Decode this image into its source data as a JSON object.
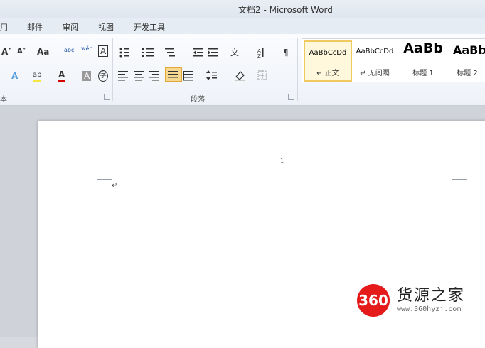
{
  "window": {
    "title": "文档2 - Microsoft Word"
  },
  "tabs": [
    "用",
    "邮件",
    "审阅",
    "视图",
    "开发工具"
  ],
  "ribbon": {
    "font_buttons": [
      "A˄",
      "A˅",
      "Aa",
      "abc",
      "wén",
      "A",
      "A",
      "ab",
      "A",
      "A",
      "字"
    ],
    "paragraph_group_label": "段落",
    "font_group_label": "本",
    "styles": [
      {
        "sample": "AaBbCcDd",
        "name": "↵ 正文"
      },
      {
        "sample": "AaBbCcDd",
        "name": "↵ 无间隔"
      },
      {
        "sample": "AaBb",
        "name": "标题 1"
      },
      {
        "sample": "AaBb",
        "name": "标题 2"
      }
    ]
  },
  "document": {
    "page_number": "1",
    "paragraph_mark": "↵"
  },
  "watermark": {
    "badge": "360",
    "name": "货源之家",
    "url": "www.360hyzj.com"
  }
}
